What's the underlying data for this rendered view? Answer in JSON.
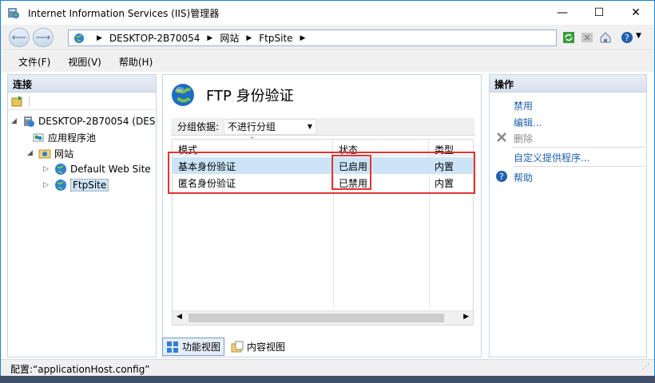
{
  "window": {
    "title": "Internet Information Services (IIS)管理器",
    "minimize": "—",
    "maximize": "☐",
    "close": "✕"
  },
  "address": {
    "crumbs": [
      "DESKTOP-2B70054",
      "网站",
      "FtpSite"
    ]
  },
  "menu": {
    "file": "文件(F)",
    "view": "视图(V)",
    "help": "帮助(H)"
  },
  "left": {
    "header": "连接",
    "tree": {
      "server": "DESKTOP-2B70054 (DES",
      "app_pools": "应用程序池",
      "sites": "网站",
      "default_site": "Default Web Site",
      "ftp_site": "FtpSite"
    }
  },
  "center": {
    "title": "FTP 身份验证",
    "group_label": "分组依据:",
    "group_value": "不进行分组",
    "columns": [
      "模式",
      "状态",
      "类型"
    ],
    "rows": [
      {
        "mode": "基本身份验证",
        "status": "已启用",
        "type": "内置"
      },
      {
        "mode": "匿名身份验证",
        "status": "已禁用",
        "type": "内置"
      }
    ],
    "view_tabs": [
      "功能视图",
      "内容视图"
    ]
  },
  "right": {
    "header": "操作",
    "actions": {
      "enable": "禁用",
      "edit": "编辑...",
      "remove": "删除",
      "custom": "自定义提供程序...",
      "help": "帮助"
    }
  },
  "status": {
    "config": "配置:“applicationHost.config”"
  },
  "colors": {
    "accent": "#1883d7",
    "highlight_box": "#e03535",
    "link": "#1f5fae"
  }
}
